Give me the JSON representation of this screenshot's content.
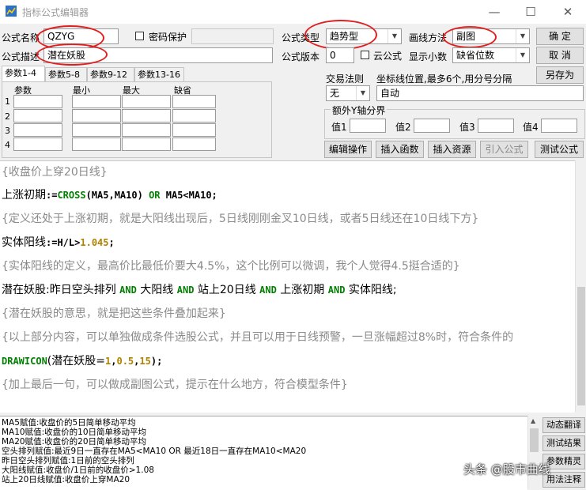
{
  "window": {
    "title": "指标公式编辑器",
    "min": "—",
    "max": "☐",
    "close": "✕"
  },
  "form": {
    "name_label": "公式名称",
    "name_value": "QZYG",
    "password_label": "密码保护",
    "type_label": "公式类型",
    "type_value": "趋势型",
    "draw_label": "画线方法",
    "draw_value": "副图",
    "desc_label": "公式描述",
    "desc_value": "潜在妖股",
    "version_label": "公式版本",
    "version_value": "0",
    "cloud_label": "云公式",
    "decimals_label": "显示小数",
    "decimals_value": "缺省位数",
    "ok": "确 定",
    "cancel": "取 消",
    "saveas": "另存为"
  },
  "tabs": [
    "参数1-4",
    "参数5-8",
    "参数9-12",
    "参数13-16"
  ],
  "params": {
    "headers": [
      "参数",
      "最小",
      "最大",
      "缺省"
    ],
    "rows": [
      "1",
      "2",
      "3",
      "4"
    ]
  },
  "trade": {
    "label": "交易法则",
    "value": "无",
    "coord_label": "坐标线位置,最多6个,用分号分隔",
    "coord_value": "自动"
  },
  "yaxis": {
    "legend": "额外Y轴分界",
    "labels": [
      "值1",
      "值2",
      "值3",
      "值4"
    ]
  },
  "actions": [
    "编辑操作",
    "插入函数",
    "插入资源",
    "引入公式",
    "测试公式"
  ],
  "code": {
    "l1": "{收盘价上穿20日线}",
    "l2a": "上涨初期",
    "l2b": ":=",
    "l2c": "CROSS",
    "l2d": "(MA5,MA10) ",
    "l2e": "OR",
    "l2f": " MA5<MA10;",
    "l3": "{定义还处于上涨初期，就是大阳线出现后，5日线刚刚金叉10日线，或者5日线还在10日线下方}",
    "l4a": "实体阳线",
    "l4b": ":=",
    "l4c": "H/L",
    "l4d": ">",
    "l4e": "1.045",
    "l4f": ";",
    "l5": "{实体阳线的定义，最高价比最低价要大4.5%，这个比例可以微调，我个人觉得4.5挺合适的}",
    "l6a": "潜在妖股",
    "l6b": ":昨日空头排列 ",
    "l6c": "AND",
    "l6d": " 大阳线 ",
    "l6e": "AND",
    "l6f": " 站上20日线 ",
    "l6g": "AND",
    "l6h": " 上涨初期 ",
    "l6i": "AND",
    "l6j": " 实体阳线;",
    "l7": "{潜在妖股的意思，就是把这些条件叠加起来}",
    "l8": "{以上部分内容，可以单独做成条件选股公式，并且可以用于日线预警，一旦涨幅超过8%时，符合条件的",
    "l9a": "DRAWICON",
    "l9b": "(潜在妖股=",
    "l9c": "1",
    "l9d": ",",
    "l9e": "0.5",
    "l9f": ",",
    "l9g": "15",
    "l9h": ");",
    "l10": "{加上最后一句，可以做成副图公式，提示在什么地方，符合模型条件}"
  },
  "output": [
    "MA5赋值:收盘价的5日简单移动平均",
    "MA10赋值:收盘价的10日简单移动平均",
    "MA20赋值:收盘价的20日简单移动平均",
    "空头排列赋值:最近9日一直存在MA5<MA10 OR 最近18日一直存在MA10<MA20",
    "昨日空头排列赋值:1日前的空头排列",
    "大阳线赋值:收盘价/1日前的收盘价>1.08",
    "站上20日线赋值:收盘价上穿MA20"
  ],
  "side": [
    "动态翻译",
    "测试结果",
    "参数精灵",
    "用法注释"
  ],
  "watermark": "头条 @股市曲线",
  "colors": {
    "keyword": "#008000",
    "number": "#b08000",
    "comment": "#8a8a8a",
    "annotation": "#e02020"
  }
}
